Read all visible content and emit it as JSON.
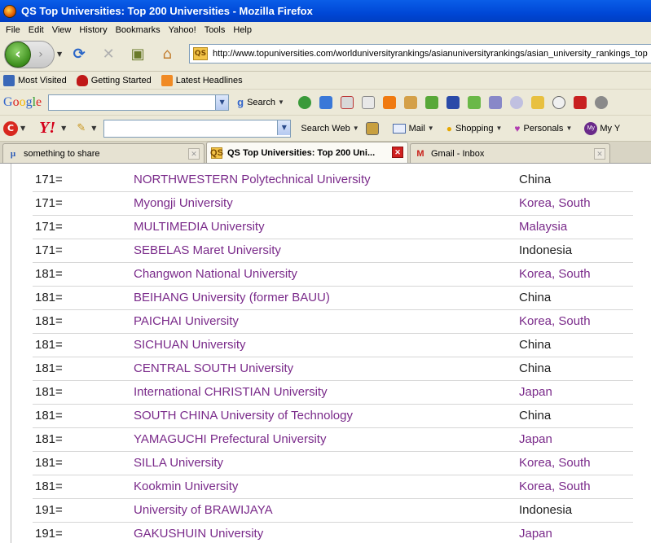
{
  "window": {
    "title": "QS Top Universities: Top 200 Universities - Mozilla Firefox"
  },
  "menu": [
    "File",
    "Edit",
    "View",
    "History",
    "Bookmarks",
    "Yahoo!",
    "Tools",
    "Help"
  ],
  "nav": {
    "url": "http://www.topuniversities.com/worlduniversityrankings/asianuniversityrankings/asian_university_rankings_top",
    "site_icon_label": "QS"
  },
  "bookmarks": [
    "Most Visited",
    "Getting Started",
    "Latest Headlines"
  ],
  "google_toolbar": {
    "logo": "Google",
    "search_label": "Search"
  },
  "yahoo_toolbar": {
    "logo": "Y!",
    "search_web_label": "Search Web",
    "mail_label": "Mail",
    "shopping_label": "Shopping",
    "personals_label": "Personals",
    "my_yahoo_label": "My Y"
  },
  "tabs": [
    {
      "label": "something to share",
      "icon": "mu-icon",
      "active": false
    },
    {
      "label": "QS Top Universities: Top 200 Uni...",
      "icon": "qs-icon",
      "active": true
    },
    {
      "label": "Gmail - Inbox",
      "icon": "gmail-icon",
      "active": false
    }
  ],
  "colors": {
    "link": "#7a2a8a",
    "visited_country": "#7a2a8a",
    "country_plain": "#1e1e1e"
  },
  "rankings": [
    {
      "rank": "171=",
      "university": "NORTHWESTERN Polytechnical University",
      "country": "China",
      "country_linked": false
    },
    {
      "rank": "171=",
      "university": "Myongji University",
      "country": "Korea, South",
      "country_linked": true
    },
    {
      "rank": "171=",
      "university": "MULTIMEDIA University",
      "country": "Malaysia",
      "country_linked": true
    },
    {
      "rank": "171=",
      "university": "SEBELAS Maret University",
      "country": "Indonesia",
      "country_linked": false
    },
    {
      "rank": "181=",
      "university": "Changwon National University",
      "country": "Korea, South",
      "country_linked": true
    },
    {
      "rank": "181=",
      "university": "BEIHANG University (former BAUU)",
      "country": "China",
      "country_linked": false
    },
    {
      "rank": "181=",
      "university": "PAICHAI University",
      "country": "Korea, South",
      "country_linked": true
    },
    {
      "rank": "181=",
      "university": "SICHUAN University",
      "country": "China",
      "country_linked": false
    },
    {
      "rank": "181=",
      "university": "CENTRAL SOUTH University",
      "country": "China",
      "country_linked": false
    },
    {
      "rank": "181=",
      "university": "International CHRISTIAN University",
      "country": "Japan",
      "country_linked": true
    },
    {
      "rank": "181=",
      "university": "SOUTH CHINA University of Technology",
      "country": "China",
      "country_linked": false
    },
    {
      "rank": "181=",
      "university": "YAMAGUCHI Prefectural University",
      "country": "Japan",
      "country_linked": true
    },
    {
      "rank": "181=",
      "university": "SILLA University",
      "country": "Korea, South",
      "country_linked": true
    },
    {
      "rank": "181=",
      "university": "Kookmin University",
      "country": "Korea, South",
      "country_linked": true
    },
    {
      "rank": "191=",
      "university": "University of BRAWIJAYA",
      "country": "Indonesia",
      "country_linked": false
    },
    {
      "rank": "191=",
      "university": "GAKUSHUIN University",
      "country": "Japan",
      "country_linked": true
    }
  ]
}
